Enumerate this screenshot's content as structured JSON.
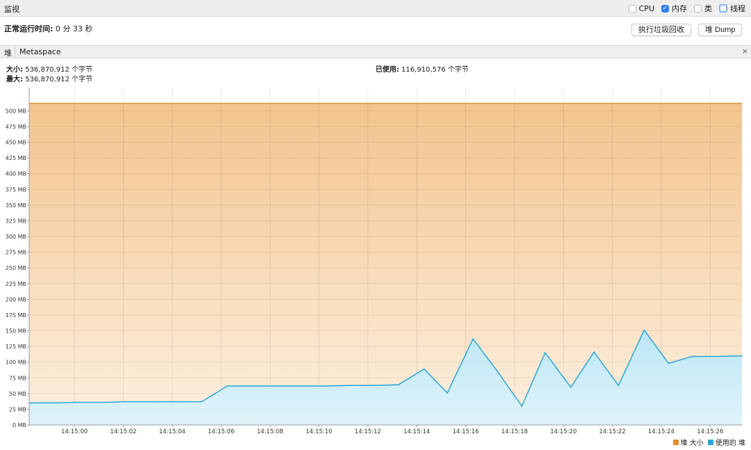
{
  "window": {
    "title": "监视"
  },
  "options": [
    {
      "label": "CPU",
      "checked": false
    },
    {
      "label": "内存",
      "checked": true
    },
    {
      "label": "类",
      "checked": false
    },
    {
      "label": "线程",
      "checked": false
    }
  ],
  "uptime": {
    "label": "正常运行时间:",
    "value": "0 分 33 秒"
  },
  "buttons": {
    "gc": "执行垃圾回收",
    "heap_dump": "堆 Dump"
  },
  "tabs": {
    "heap": "堆",
    "metaspace": "Metaspace",
    "close": "×"
  },
  "info": {
    "size_label": "大小:",
    "size_value": "536,870,912 个字节",
    "max_label": "最大:",
    "max_value": "536,870,912 个字节",
    "used_label": "已使用:",
    "used_value": "116,910,576 个字节"
  },
  "colors": {
    "heap_size": "#e0902e",
    "used_heap": "#2aa6d8"
  },
  "chart_data": {
    "type": "area",
    "x_ticks": [
      "14:15:00",
      "14:15:02",
      "14:15:04",
      "14:15:06",
      "14:15:08",
      "14:15:10",
      "14:15:12",
      "14:15:14",
      "14:15:16",
      "14:15:18",
      "14:15:20",
      "14:15:22",
      "14:15:24",
      "14:15:26"
    ],
    "x_tick_seconds": [
      0,
      2,
      4,
      6,
      8,
      10,
      12,
      14,
      16,
      18,
      20,
      22,
      24,
      26
    ],
    "xlim": [
      -1.85,
      27.3
    ],
    "y_ticks": [
      "0 MB",
      "25 MB",
      "50 MB",
      "75 MB",
      "100 MB",
      "125 MB",
      "150 MB",
      "175 MB",
      "200 MB",
      "225 MB",
      "250 MB",
      "275 MB",
      "300 MB",
      "325 MB",
      "350 MB",
      "375 MB",
      "400 MB",
      "425 MB",
      "450 MB",
      "475 MB",
      "500 MB"
    ],
    "ylim": [
      0,
      537
    ],
    "grid": true,
    "legend_position": "bottom-right",
    "series": [
      {
        "name": "堆 大小",
        "x": [
          -1.85,
          27.3
        ],
        "y": [
          512,
          512
        ]
      },
      {
        "name": "使用的 堆",
        "x": [
          -1.85,
          -0.75,
          0,
          1.25,
          2,
          3.25,
          4.2,
          5.2,
          6.25,
          7.3,
          8.25,
          9.25,
          10.3,
          11.25,
          12.3,
          13.25,
          14.3,
          15.25,
          16.3,
          17.25,
          18.3,
          19.25,
          20.3,
          21.25,
          22.25,
          23.3,
          24.3,
          25.25,
          26.3,
          27.3
        ],
        "y": [
          35,
          35,
          36,
          36,
          37,
          37,
          37,
          37,
          62,
          62,
          62,
          62,
          62,
          63,
          63,
          64,
          89,
          51,
          137,
          88,
          30,
          115,
          60,
          116,
          63,
          151,
          98,
          109,
          109,
          110
        ]
      }
    ]
  }
}
